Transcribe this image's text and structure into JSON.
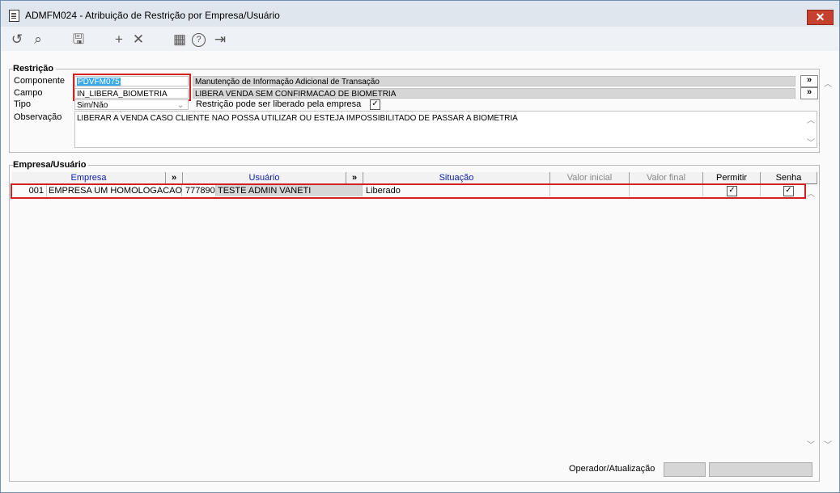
{
  "window": {
    "title": "ADMFM024 - Atribuição de Restrição por Empresa/Usuário",
    "close_glyph": "✕"
  },
  "toolbar": {
    "icons": [
      "undo-icon",
      "search-icon",
      "save-icon",
      "add-icon",
      "delete-icon",
      "calendar-icon",
      "help-icon",
      "exit-icon"
    ],
    "glyphs": {
      "undo": "↺",
      "search": "⌕",
      "save": "🖫",
      "add": "+",
      "delete": "✕",
      "calendar": "▦",
      "help": "?",
      "exit": "⇥"
    }
  },
  "restricao": {
    "group_title": "Restrição",
    "componente_label": "Componente",
    "componente_code": "PDVFM075",
    "componente_desc": "Manutenção de Informação Adicional de Transação",
    "campo_label": "Campo",
    "campo_code": "IN_LIBERA_BIOMETRIA",
    "campo_desc": "LIBERA VENDA SEM CONFIRMACAO DE BIOMETRIA",
    "tipo_label": "Tipo",
    "tipo_value": "Sim/Não",
    "liberado_label": "Restrição pode ser liberado pela empresa",
    "liberado_checked": true,
    "observacao_label": "Observação",
    "observacao_text": "LIBERAR A VENDA CASO CLIENTE NAO POSSA UTILIZAR OU ESTEJA IMPOSSIBILITADO DE PASSAR A BIOMETRIA",
    "lookup_glyph": "»"
  },
  "empresa_usuario": {
    "group_title": "Empresa/Usuário",
    "columns": {
      "empresa": "Empresa",
      "usuario": "Usuário",
      "situacao": "Situação",
      "valor_inicial": "Valor inicial",
      "valor_final": "Valor final",
      "permitir": "Permitir",
      "senha": "Senha"
    },
    "rows": [
      {
        "empresa_code": "001",
        "empresa_name": "EMPRESA UM HOMOLOGACAO",
        "usuario_code": "777890",
        "usuario_name": "TESTE ADMIN VANETI",
        "situacao": "Liberado",
        "valor_inicial": "",
        "valor_final": "",
        "permitir": true,
        "senha": true
      }
    ]
  },
  "footer": {
    "operador_label": "Operador/Atualização"
  },
  "colors": {
    "highlight_border": "#d62020",
    "selection": "#39a9ec",
    "header_blue": "#0a1fa3"
  }
}
